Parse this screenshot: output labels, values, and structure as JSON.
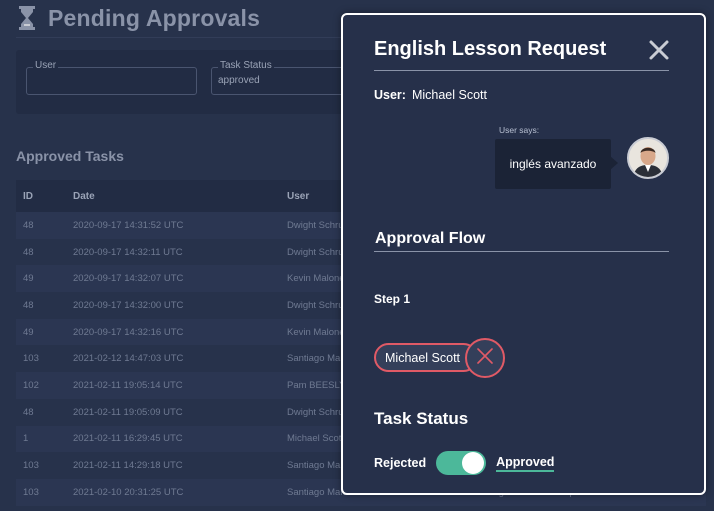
{
  "page": {
    "title": "Pending Approvals"
  },
  "filters": {
    "user_label": "User",
    "user_value": "",
    "status_label": "Task Status",
    "status_value": "approved"
  },
  "approved": {
    "section_title": "Approved Tasks",
    "columns": [
      "ID",
      "Date",
      "User"
    ],
    "rows": [
      {
        "id": "48",
        "date": "2020-09-17 14:31:52 UTC",
        "user": "Dwight Schru"
      },
      {
        "id": "48",
        "date": "2020-09-17 14:32:11 UTC",
        "user": "Dwight Schru"
      },
      {
        "id": "49",
        "date": "2020-09-17 14:32:07 UTC",
        "user": "Kevin Malone"
      },
      {
        "id": "48",
        "date": "2020-09-17 14:32:00 UTC",
        "user": "Dwight Schru"
      },
      {
        "id": "49",
        "date": "2020-09-17 14:32:16 UTC",
        "user": "Kevin Malone"
      },
      {
        "id": "103",
        "date": "2021-02-12 14:47:03 UTC",
        "user": "Santiago Mald"
      },
      {
        "id": "102",
        "date": "2021-02-11 19:05:14 UTC",
        "user": "Pam BEESLY"
      },
      {
        "id": "48",
        "date": "2021-02-11 19:05:09 UTC",
        "user": "Dwight Schru"
      },
      {
        "id": "1",
        "date": "2021-02-11 16:29:45 UTC",
        "user": "Michael Scott"
      },
      {
        "id": "103",
        "date": "2021-02-11 14:29:18 UTC",
        "user": "Santiago Mald"
      },
      {
        "id": "103",
        "date": "2021-02-10 20:31:25 UTC",
        "user": "Santiago Maldonado",
        "task": "English Lesson Request"
      }
    ]
  },
  "modal": {
    "title": "English Lesson Request",
    "user_label": "User:",
    "user_name": "Michael Scott",
    "says_label": "User says:",
    "message": "inglés avanzado",
    "approval_flow_title": "Approval Flow",
    "step_label": "Step 1",
    "approver_name": "Michael Scott",
    "task_status_title": "Task Status",
    "toggle_left": "Rejected",
    "toggle_right": "Approved",
    "toggle_on": true
  },
  "colors": {
    "background": "#27324b",
    "accent_red": "#e05a66",
    "accent_green": "#4cb89a"
  },
  "icons": [
    "hourglass-icon",
    "close-icon",
    "avatar",
    "remove-x-icon"
  ]
}
